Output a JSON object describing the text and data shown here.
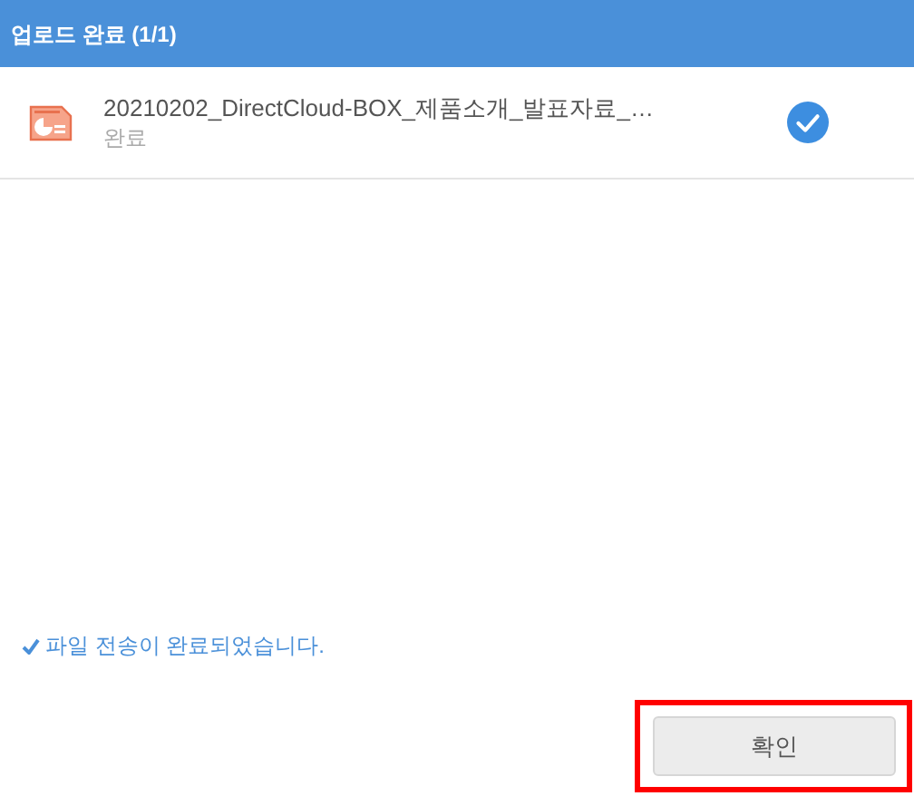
{
  "header": {
    "title": "업로드 완료 (1/1)"
  },
  "files": [
    {
      "name": "20210202_DirectCloud-BOX_제품소개_발표자료_…",
      "status": "완료",
      "done": true
    }
  ],
  "message": "파일 전송이 완료되었습니다.",
  "button": {
    "label": "확인",
    "highlighted": true
  }
}
